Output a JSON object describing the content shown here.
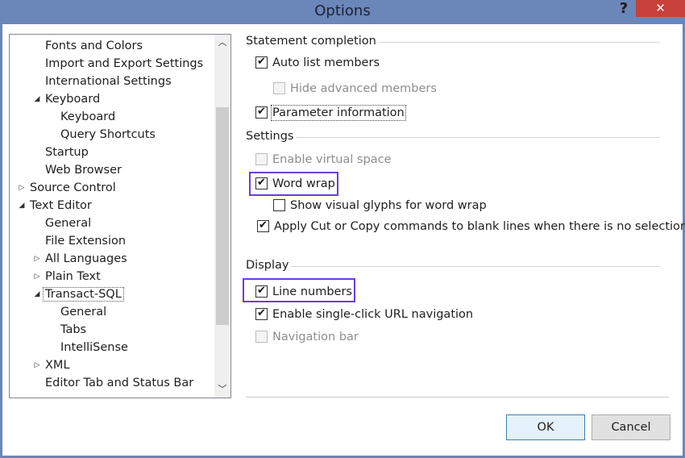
{
  "window": {
    "title": "Options",
    "help_label": "?",
    "close_label": "✕"
  },
  "tree": {
    "items": [
      {
        "label": "Fonts and Colors"
      },
      {
        "label": "Import and Export Settings"
      },
      {
        "label": "International Settings"
      },
      {
        "label": "Keyboard"
      },
      {
        "label": "Keyboard"
      },
      {
        "label": "Query Shortcuts"
      },
      {
        "label": "Startup"
      },
      {
        "label": "Web Browser"
      },
      {
        "label": "Source Control"
      },
      {
        "label": "Text Editor"
      },
      {
        "label": "General"
      },
      {
        "label": "File Extension"
      },
      {
        "label": "All Languages"
      },
      {
        "label": "Plain Text"
      },
      {
        "label": "Transact-SQL"
      },
      {
        "label": "General"
      },
      {
        "label": "Tabs"
      },
      {
        "label": "IntelliSense"
      },
      {
        "label": "XML"
      },
      {
        "label": "Editor Tab and Status Bar"
      }
    ]
  },
  "groups": {
    "statement_completion": "Statement completion",
    "settings": "Settings",
    "display": "Display"
  },
  "options": {
    "auto_list_members": {
      "label": "Auto list members",
      "checked": true,
      "enabled": true
    },
    "hide_advanced_members": {
      "label": "Hide advanced members",
      "checked": false,
      "enabled": false
    },
    "parameter_information": {
      "label": "Parameter information",
      "checked": true,
      "enabled": true
    },
    "enable_virtual_space": {
      "label": "Enable virtual space",
      "checked": false,
      "enabled": false
    },
    "word_wrap": {
      "label": "Word wrap",
      "checked": true,
      "enabled": true
    },
    "show_visual_glyphs": {
      "label": "Show visual glyphs for word wrap",
      "checked": false,
      "enabled": true
    },
    "apply_cut_copy": {
      "label": "Apply Cut or Copy commands to blank lines when there is no selection",
      "checked": true,
      "enabled": true
    },
    "line_numbers": {
      "label": "Line numbers",
      "checked": true,
      "enabled": true
    },
    "single_click_url": {
      "label": "Enable single-click URL navigation",
      "checked": true,
      "enabled": true
    },
    "navigation_bar": {
      "label": "Navigation bar",
      "checked": false,
      "enabled": false
    }
  },
  "buttons": {
    "ok": "OK",
    "cancel": "Cancel"
  },
  "colors": {
    "title_bar": "#6b86b9",
    "close": "#c7403a",
    "highlight": "#6a3fd6",
    "ok_border": "#3c7fb1"
  }
}
